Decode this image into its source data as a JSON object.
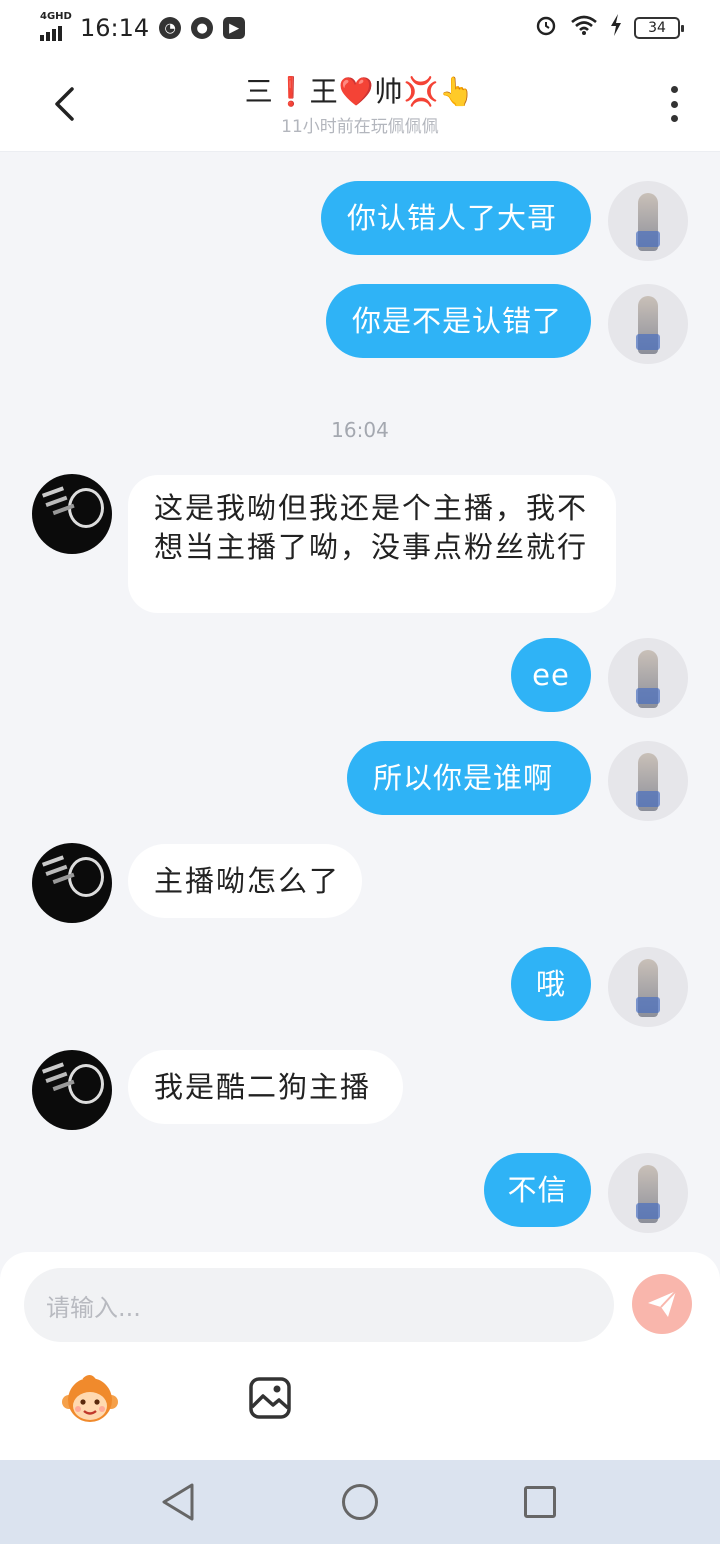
{
  "status_bar": {
    "network": "4GHD",
    "time": "16:14",
    "battery": "34"
  },
  "header": {
    "title": "三❗王❤️帅💢👆",
    "subtitle": "11小时前在玩佩佩佩"
  },
  "messages": [
    {
      "side": "out",
      "text": "你认错人了大哥"
    },
    {
      "side": "out",
      "text": "你是不是认错了"
    },
    {
      "side": "in",
      "text": "这是我呦但我还是个主播，我不想当主播了呦，没事点粉丝就行"
    },
    {
      "side": "out",
      "text": "ee"
    },
    {
      "side": "out",
      "text": "所以你是谁啊"
    },
    {
      "side": "in",
      "text": "主播呦怎么了"
    },
    {
      "side": "out",
      "text": "哦"
    },
    {
      "side": "in",
      "text": "我是酷二狗主播"
    },
    {
      "side": "out",
      "text": "不信"
    }
  ],
  "timestamp": "16:04",
  "composer": {
    "placeholder": "请输入..."
  },
  "colors": {
    "outgoing_bubble": "#2fb3f6",
    "incoming_bubble": "#ffffff",
    "send_button": "#f9b6ac",
    "background": "#f4f5f8"
  },
  "icons": {
    "back": "chevron-left-icon",
    "more": "vertical-dots-icon",
    "send": "paper-plane-icon",
    "emoji": "monkey-emoji-icon",
    "image": "image-icon"
  }
}
